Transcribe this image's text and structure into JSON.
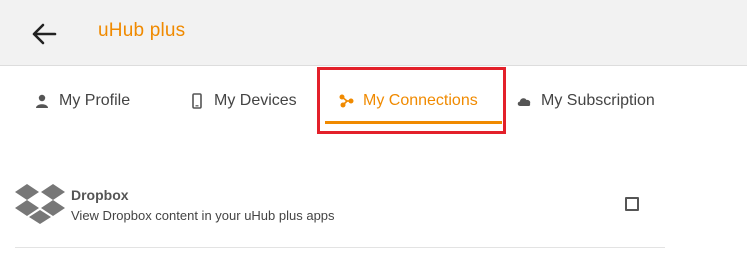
{
  "header": {
    "back_icon": "arrow-left-icon",
    "title": "uHub plus"
  },
  "tabs": [
    {
      "label": "My Profile",
      "icon": "person-icon",
      "active": false
    },
    {
      "label": "My Devices",
      "icon": "phone-icon",
      "active": false
    },
    {
      "label": "My Connections",
      "icon": "connections-icon",
      "active": true
    },
    {
      "label": "My Subscription",
      "icon": "cloud-icon",
      "active": false
    }
  ],
  "connections": [
    {
      "name": "Dropbox",
      "description": "View Dropbox content in your uHub plus apps",
      "icon": "dropbox-logo-icon",
      "checked": false
    }
  ],
  "colors": {
    "accent": "#f08a00",
    "highlight": "#e3202a",
    "header_bg": "#f2f2f2"
  }
}
